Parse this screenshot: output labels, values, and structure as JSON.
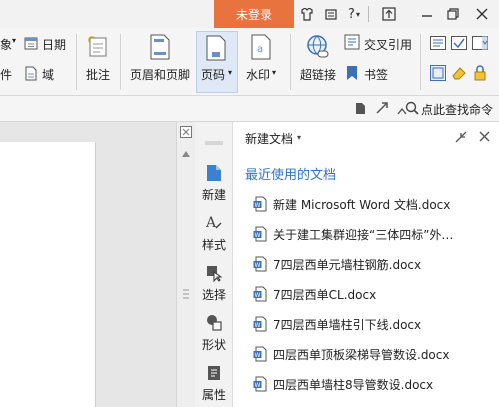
{
  "titlebar": {
    "login_label": "未登录"
  },
  "ribbon": {
    "partial_left_top": "象",
    "partial_left_bottom": "件",
    "date_label": "日期",
    "field_label": "域",
    "annotation_label": "批注",
    "header_footer_label": "页眉和页脚",
    "page_number_label": "页码",
    "watermark_label": "水印",
    "hyperlink_label": "超链接",
    "cross_ref_label": "交叉引用",
    "bookmark_label": "书签"
  },
  "cmdbar": {
    "find_label": "点此查找命令"
  },
  "sidetabs": [
    {
      "label": "新建",
      "icon": "new-doc-icon"
    },
    {
      "label": "样式",
      "icon": "style-icon"
    },
    {
      "label": "选择",
      "icon": "select-icon"
    },
    {
      "label": "形状",
      "icon": "shape-icon"
    },
    {
      "label": "属性",
      "icon": "properties-icon"
    }
  ],
  "panel": {
    "title": "新建文档",
    "recent_title": "最近使用的文档",
    "files": [
      "新建 Microsoft Word 文档.docx",
      "关于建工集群迎接“三体四标”外…",
      "7四层西单元墙柱钢筋.docx",
      "7四层西单CL.docx",
      "7四层西单墙柱引下线.docx",
      "四层西单顶板梁梯导管数设.docx",
      "四层西单墙柱8导管数设.docx"
    ]
  },
  "colors": {
    "login_bg": "#e9733f",
    "accent_blue": "#2e75c7"
  }
}
